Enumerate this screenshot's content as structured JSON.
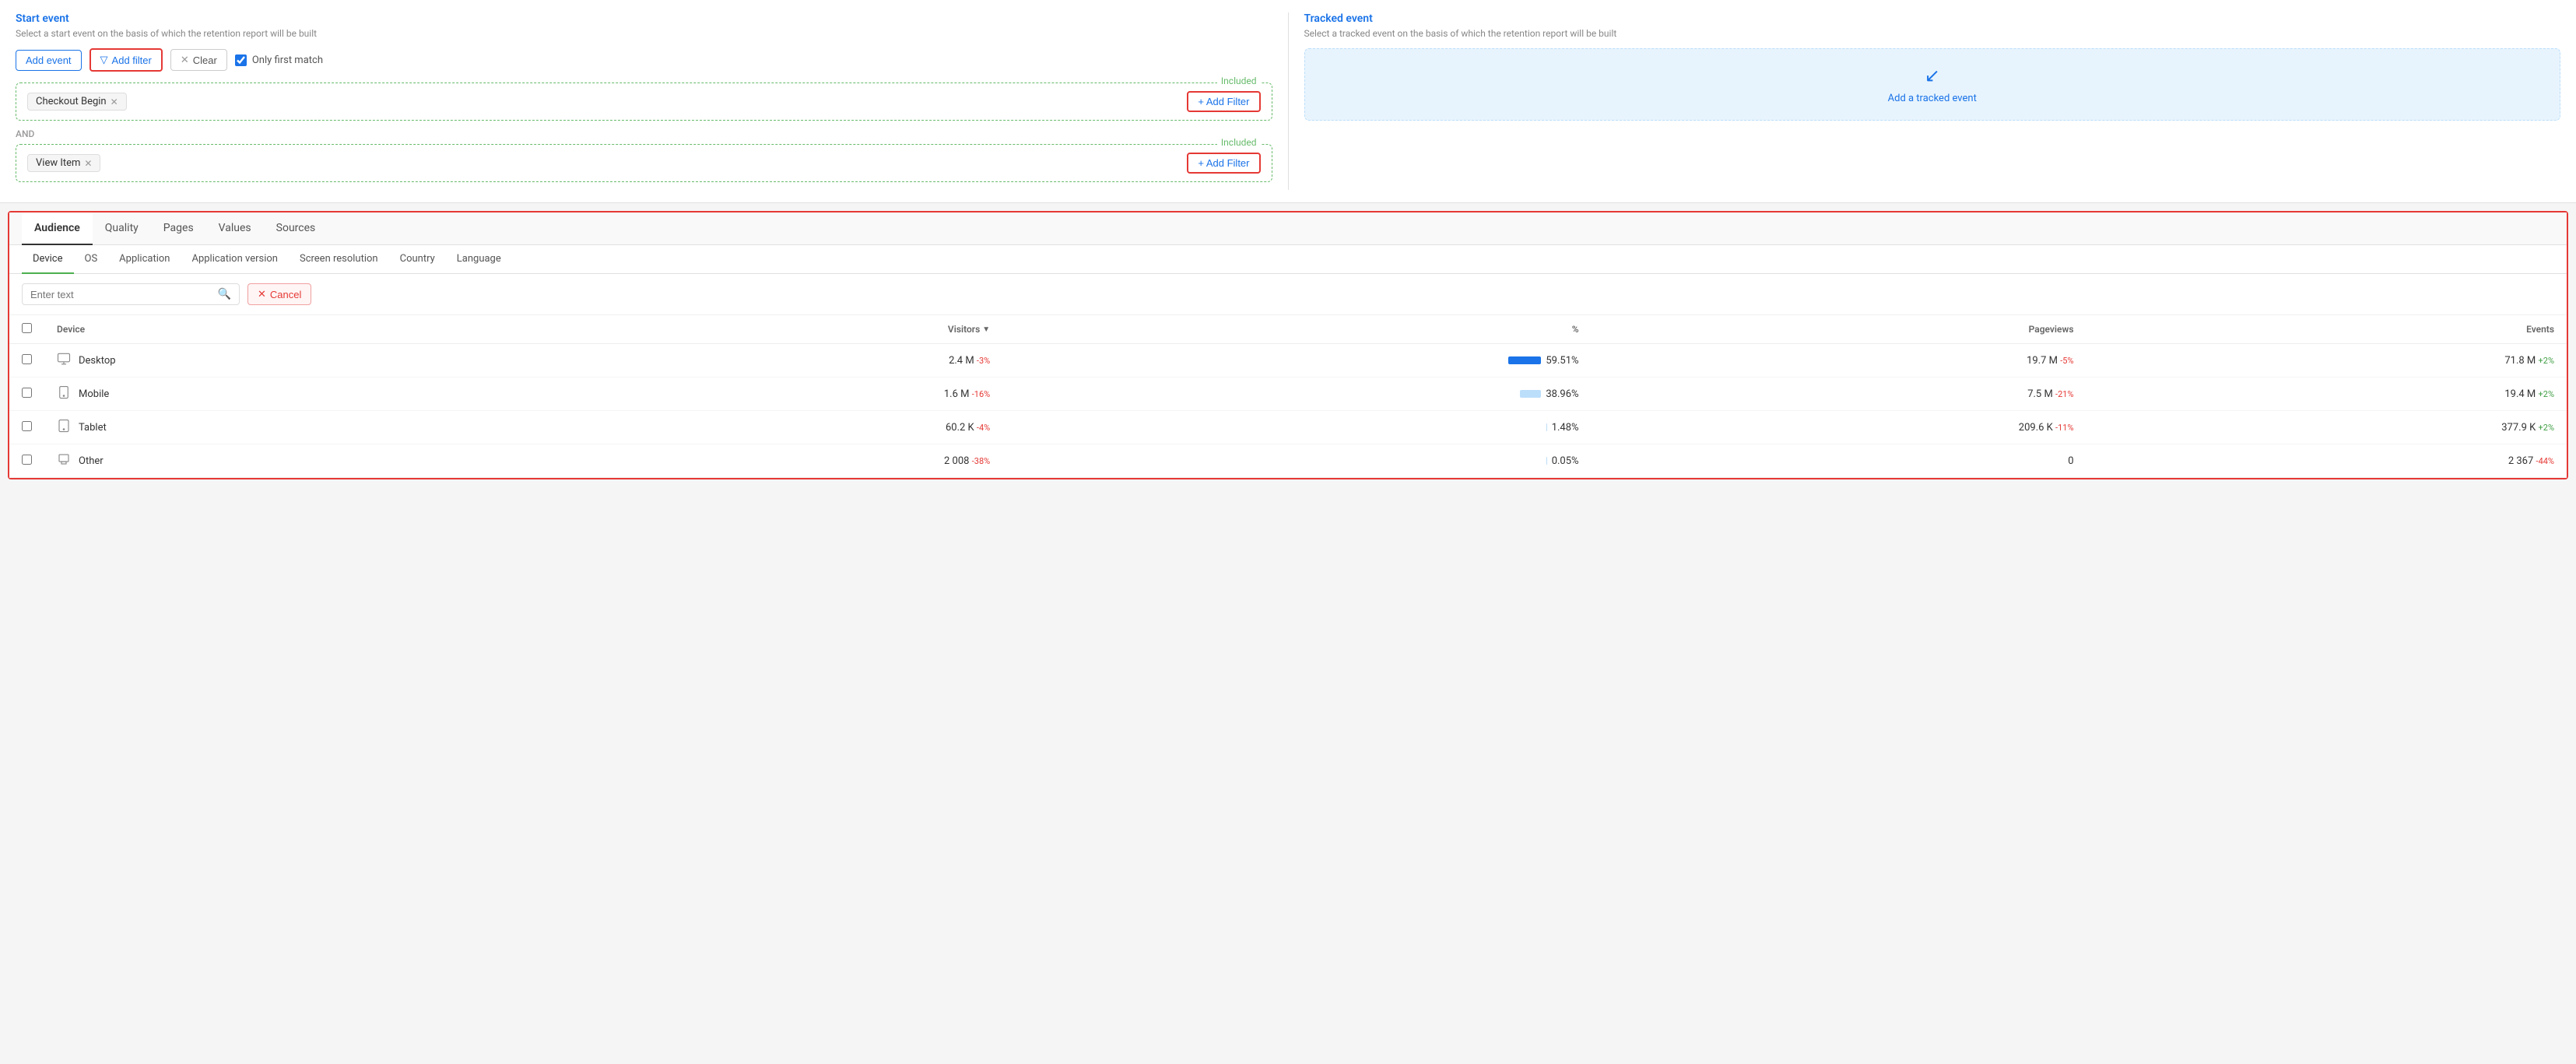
{
  "startEvent": {
    "title": "Start event",
    "subtitle": "Select a start event on the basis of which the retention report will be built",
    "toolbar": {
      "addEvent": "Add event",
      "addFilter": "Add filter",
      "clear": "Clear",
      "onlyFirstMatch": "Only first match"
    },
    "groups": [
      {
        "label": "Included",
        "tag": "Checkout Begin",
        "addFilterBtn": "+ Add Filter"
      },
      {
        "label": "Included",
        "tag": "View Item",
        "addFilterBtn": "+ Add Filter"
      }
    ],
    "andLabel": "AND"
  },
  "trackedEvent": {
    "title": "Tracked event",
    "subtitle": "Select a tracked event on the basis of which the retention report will be built",
    "addTrackedText": "Add a tracked event"
  },
  "bottomSection": {
    "tabs": [
      "Audience",
      "Quality",
      "Pages",
      "Values",
      "Sources"
    ],
    "activeTab": "Audience",
    "subTabs": [
      "Device",
      "OS",
      "Application",
      "Application version",
      "Screen resolution",
      "Country",
      "Language"
    ],
    "activeSubTab": "Device",
    "searchPlaceholder": "Enter text",
    "cancelBtn": "Cancel",
    "table": {
      "columns": [
        {
          "key": "device",
          "label": "Device"
        },
        {
          "key": "visitors",
          "label": "Visitors",
          "sort": true,
          "right": true
        },
        {
          "key": "percent",
          "label": "%",
          "right": true
        },
        {
          "key": "pageviews",
          "label": "Pageviews",
          "right": true
        },
        {
          "key": "events",
          "label": "Events",
          "right": true
        }
      ],
      "rows": [
        {
          "device": "Desktop",
          "deviceIcon": "🖥",
          "visitors": "2.4 M",
          "visitorsChange": "-3%",
          "visitorsChangeType": "neg",
          "barWidth": 60,
          "barType": "solid",
          "percent": "59.51%",
          "pageviews": "19.7 M",
          "pageviewsChange": "-5%",
          "pageviewsChangeType": "neg",
          "events": "71.8 M",
          "eventsChange": "+2%",
          "eventsChangeType": "pos"
        },
        {
          "device": "Mobile",
          "deviceIcon": "📱",
          "visitors": "1.6 M",
          "visitorsChange": "-16%",
          "visitorsChangeType": "neg",
          "barWidth": 39,
          "barType": "light",
          "percent": "38.96%",
          "pageviews": "7.5 M",
          "pageviewsChange": "-21%",
          "pageviewsChangeType": "neg",
          "events": "19.4 M",
          "eventsChange": "+2%",
          "eventsChangeType": "pos"
        },
        {
          "device": "Tablet",
          "deviceIcon": "⬜",
          "visitors": "60.2 K",
          "visitorsChange": "-4%",
          "visitorsChangeType": "neg",
          "barWidth": 1,
          "barType": "light",
          "percent": "1.48%",
          "pageviews": "209.6 K",
          "pageviewsChange": "-11%",
          "pageviewsChangeType": "neg",
          "events": "377.9 K",
          "eventsChange": "+2%",
          "eventsChangeType": "pos"
        },
        {
          "device": "Other",
          "deviceIcon": "⬜",
          "visitors": "2 008",
          "visitorsChange": "-38%",
          "visitorsChangeType": "neg",
          "barWidth": 0.5,
          "barType": "light",
          "percent": "0.05%",
          "pageviews": "0",
          "pageviewsChange": "",
          "pageviewsChangeType": "",
          "events": "2 367",
          "eventsChange": "-44%",
          "eventsChangeType": "neg"
        }
      ]
    }
  }
}
